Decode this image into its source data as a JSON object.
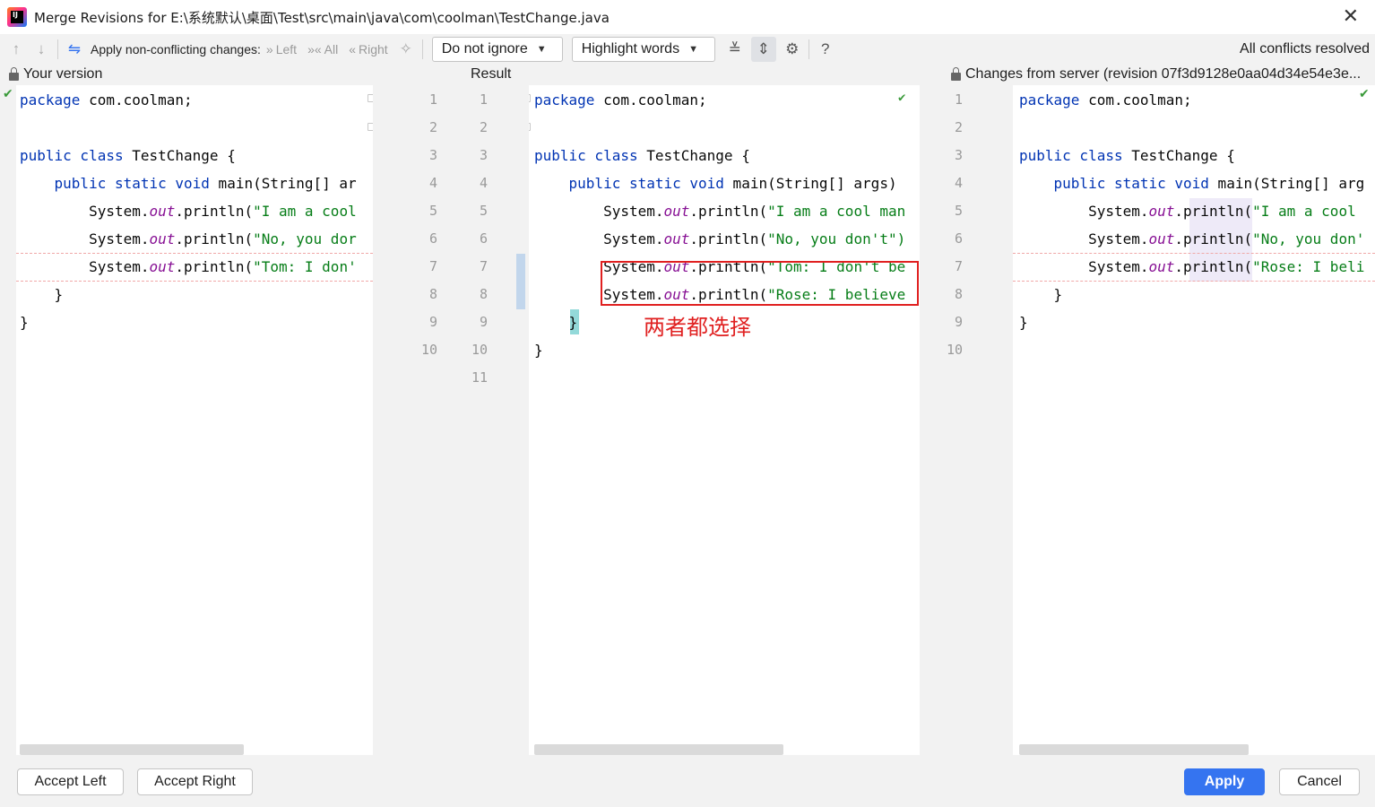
{
  "window": {
    "title": "Merge Revisions for E:\\系统默认\\桌面\\Test\\src\\main\\java\\com\\coolman\\TestChange.java",
    "close": "✕"
  },
  "toolbar": {
    "apply_label": "Apply non-conflicting changes:",
    "left": "Left",
    "all": "All",
    "right": "Right",
    "ignore_combo": "Do not ignore",
    "highlight_combo": "Highlight words",
    "status": "All conflicts resolved"
  },
  "panels": {
    "left_header": "Your version",
    "center_header": "Result",
    "right_header": "Changes from server (revision 07f3d9128e0aa04d34e54e3e..."
  },
  "left_editor": {
    "lines": [
      [
        "package",
        " com.coolman;"
      ],
      [],
      [
        "public class",
        " TestChange {"
      ],
      [
        "    public static void",
        " main(String[] ar"
      ],
      [
        "        System.",
        "out",
        ".println(\"I am a cool"
      ],
      [
        "        System.",
        "out",
        ".println(\"No, you dor"
      ],
      [
        "        System.",
        "out",
        ".println(\"Tom: I don'"
      ],
      [
        "    }"
      ],
      [
        "}"
      ]
    ],
    "numbers": [
      "1",
      "2",
      "3",
      "4",
      "5",
      "6",
      "7",
      "8",
      "9",
      "10"
    ]
  },
  "center_editor": {
    "numbers": [
      "1",
      "2",
      "3",
      "4",
      "5",
      "6",
      "7",
      "8",
      "9",
      "10",
      "11"
    ],
    "lines": [
      [
        "package",
        " com.coolman;"
      ],
      [],
      [
        "public class",
        " TestChange {"
      ],
      [
        "    public static void",
        " main(String[] args)"
      ],
      [
        "        System.",
        "out",
        ".println(\"I am a cool man"
      ],
      [
        "        System.",
        "out",
        ".println(\"No, you don't\")"
      ],
      [
        "        System.",
        "out",
        ".println(\"Tom: I don't be"
      ],
      [
        "        System.",
        "out",
        ".println(\"Rose: I believe"
      ],
      [
        "    }"
      ],
      [
        "}"
      ]
    ]
  },
  "right_editor": {
    "numbers": [
      "1",
      "2",
      "3",
      "4",
      "5",
      "6",
      "7",
      "8",
      "9",
      "10"
    ],
    "lines": [
      [
        "package",
        " com.coolman;"
      ],
      [],
      [
        "public class",
        " TestChange {"
      ],
      [
        "    public static void",
        " main(String[] arg"
      ],
      [
        "        System.",
        "out",
        ".println(\"I am a cool"
      ],
      [
        "        System.",
        "out",
        ".println(\"No, you don'"
      ],
      [
        "        System.",
        "out",
        ".println(\"Rose: I beli"
      ],
      [
        "    }"
      ],
      [
        "}"
      ]
    ]
  },
  "annotation": "两者都选择",
  "buttons": {
    "accept_left": "Accept Left",
    "accept_right": "Accept Right",
    "apply": "Apply",
    "cancel": "Cancel"
  },
  "icons": [
    "arrow-up-icon",
    "arrow-down-icon",
    "apply-changes-icon",
    "magic-wand-icon",
    "collapse-icon",
    "sync-scroll-icon",
    "settings-icon",
    "help-icon",
    "lock-icon",
    "checkmark-icon"
  ]
}
